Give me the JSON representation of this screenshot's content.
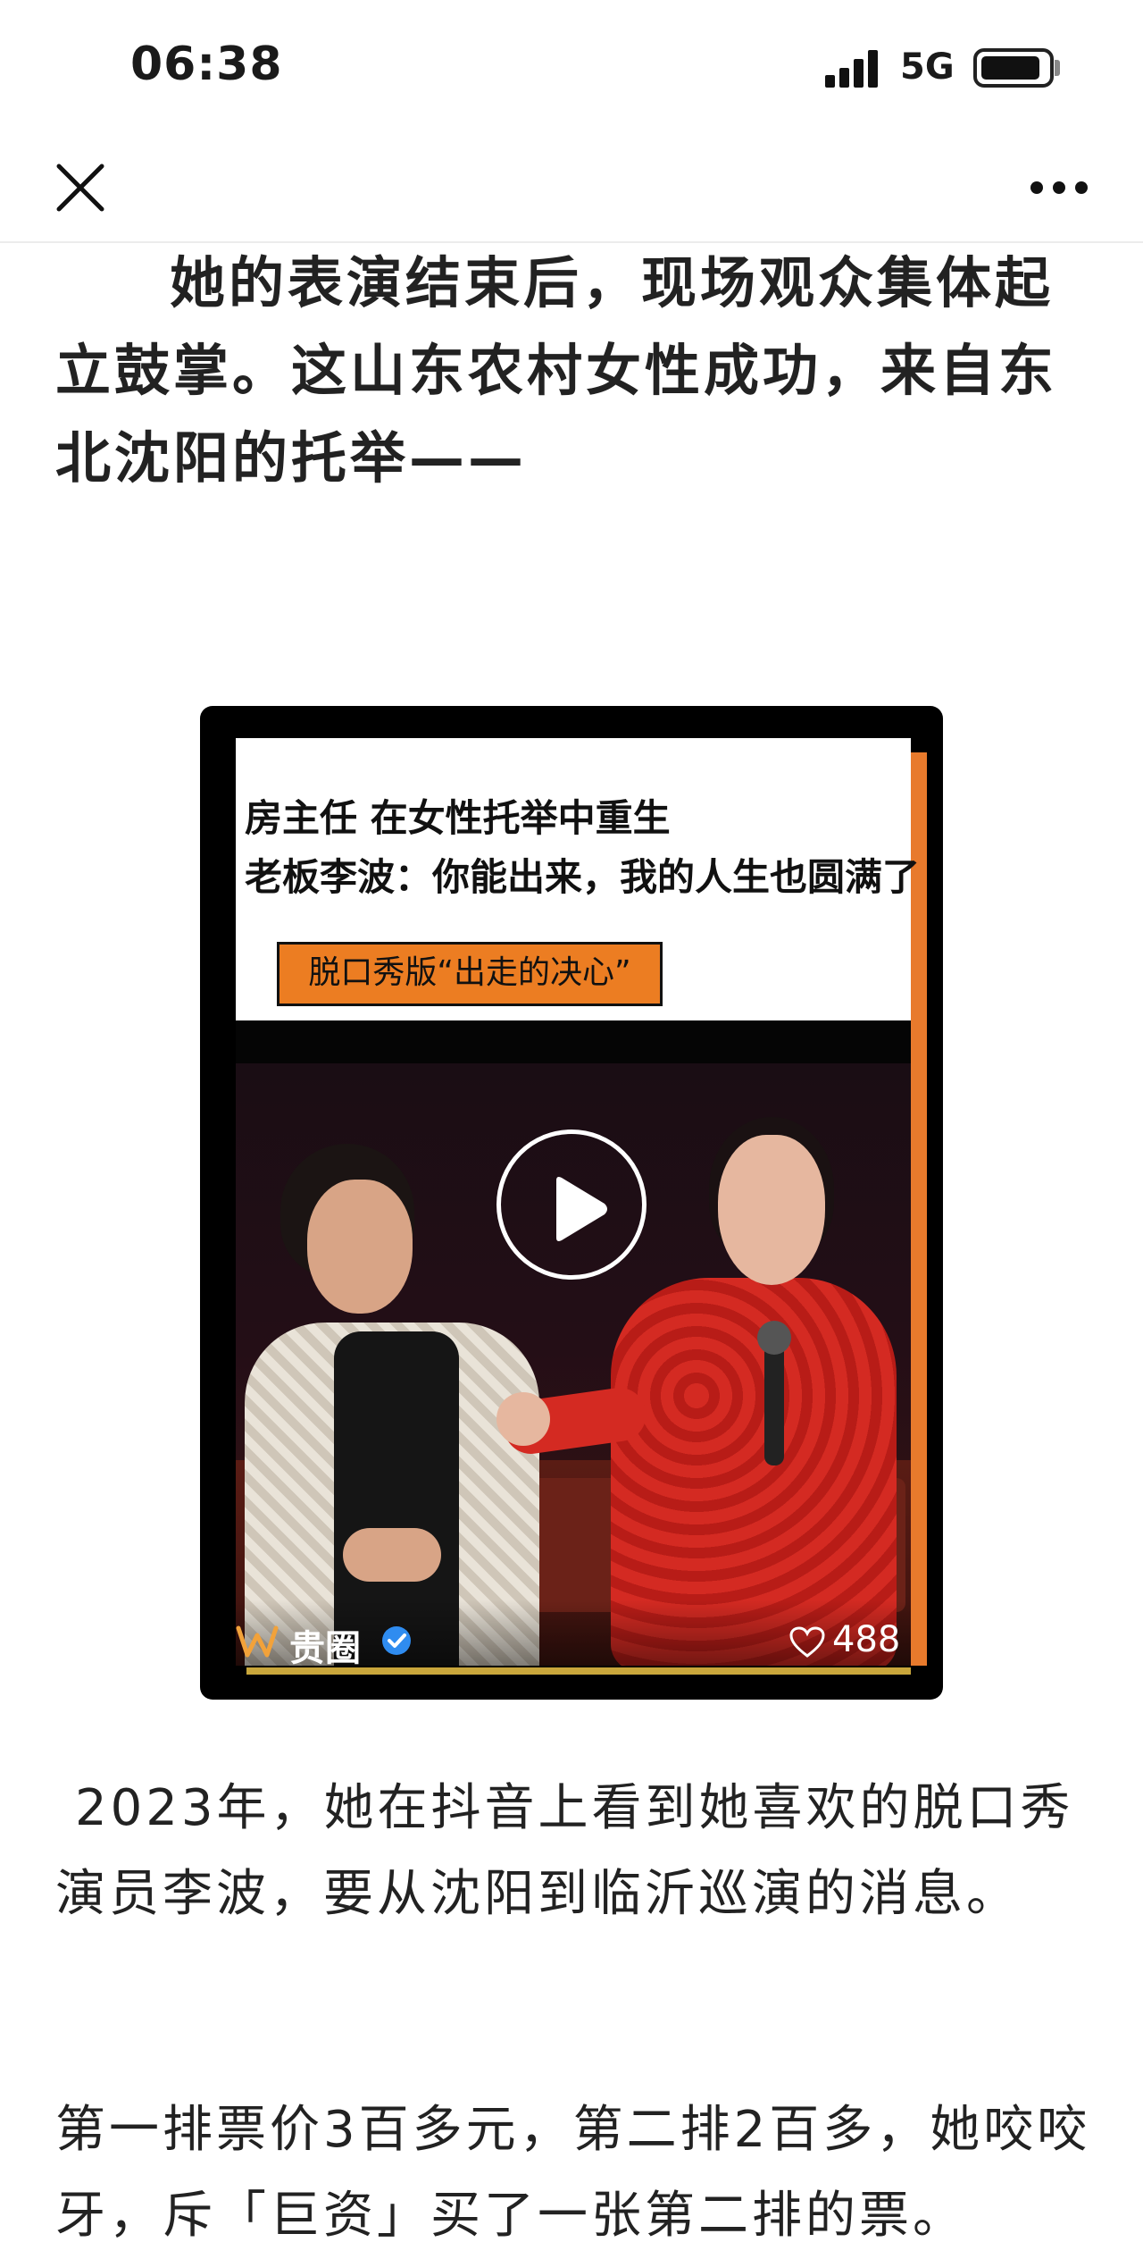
{
  "status_bar": {
    "time": "06:38",
    "network": "5G",
    "signal_bars": 4,
    "battery_level": 0.9
  },
  "nav": {
    "close_icon": "close-icon",
    "more_icon": "more-icon"
  },
  "article": {
    "paragraph_1": "她的表演结束后，现场观众集体起立鼓掌。这山东农村女性成功，来自东北沈阳的托举——",
    "paragraph_2": "2023年，她在抖音上看到她喜欢的脱口秀演员李波，要从沈阳到临沂巡演的消息。",
    "paragraph_3": "第一排票价3百多元，第二排2百多，她咬咬牙，斥「巨资」买了一张第二排的票。"
  },
  "video": {
    "headline_1": "房主任 在女性托举中重生",
    "headline_2": "老板李波：你能出来，我的人生也圆满了",
    "tag": "脱口秀版“出走的决心”",
    "account_name": "贵圈",
    "like_count": "488",
    "progress": 1.0,
    "accent_color": "#ec7d22"
  }
}
